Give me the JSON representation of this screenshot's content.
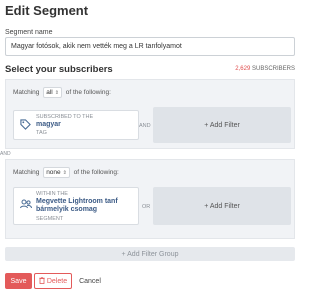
{
  "title": "Edit Segment",
  "segment": {
    "label": "Segment name",
    "value": "Magyar fotósok, akik nem vették meg a LR tanfolyamot"
  },
  "subscribers": {
    "heading": "Select your subscribers",
    "count": "2,629",
    "count_suffix": "SUBSCRIBERS"
  },
  "groups": [
    {
      "matching_prefix": "Matching",
      "matching_value": "all",
      "matching_suffix": "of the following:",
      "filter": {
        "icon": "tag-icon",
        "line1": "SUBSCRIBED TO THE",
        "line2": "magyar",
        "line3": "TAG"
      },
      "joiner": "AND",
      "add_filter": "+ Add Filter"
    },
    {
      "matching_prefix": "Matching",
      "matching_value": "none",
      "matching_suffix": "of the following:",
      "filter": {
        "icon": "segment-users-icon",
        "line1": "WITHIN THE",
        "line2": "Megvette Lightroom tanf bármelyik csomag",
        "line3": "SEGMENT"
      },
      "joiner": "OR",
      "add_filter": "+ Add Filter"
    }
  ],
  "group_joiner": "AND",
  "add_filter_group": "+ Add Filter Group",
  "buttons": {
    "save": "Save",
    "delete": "Delete",
    "cancel": "Cancel"
  },
  "colors": {
    "accent": "#e35a5a",
    "link": "#3b5a85"
  }
}
